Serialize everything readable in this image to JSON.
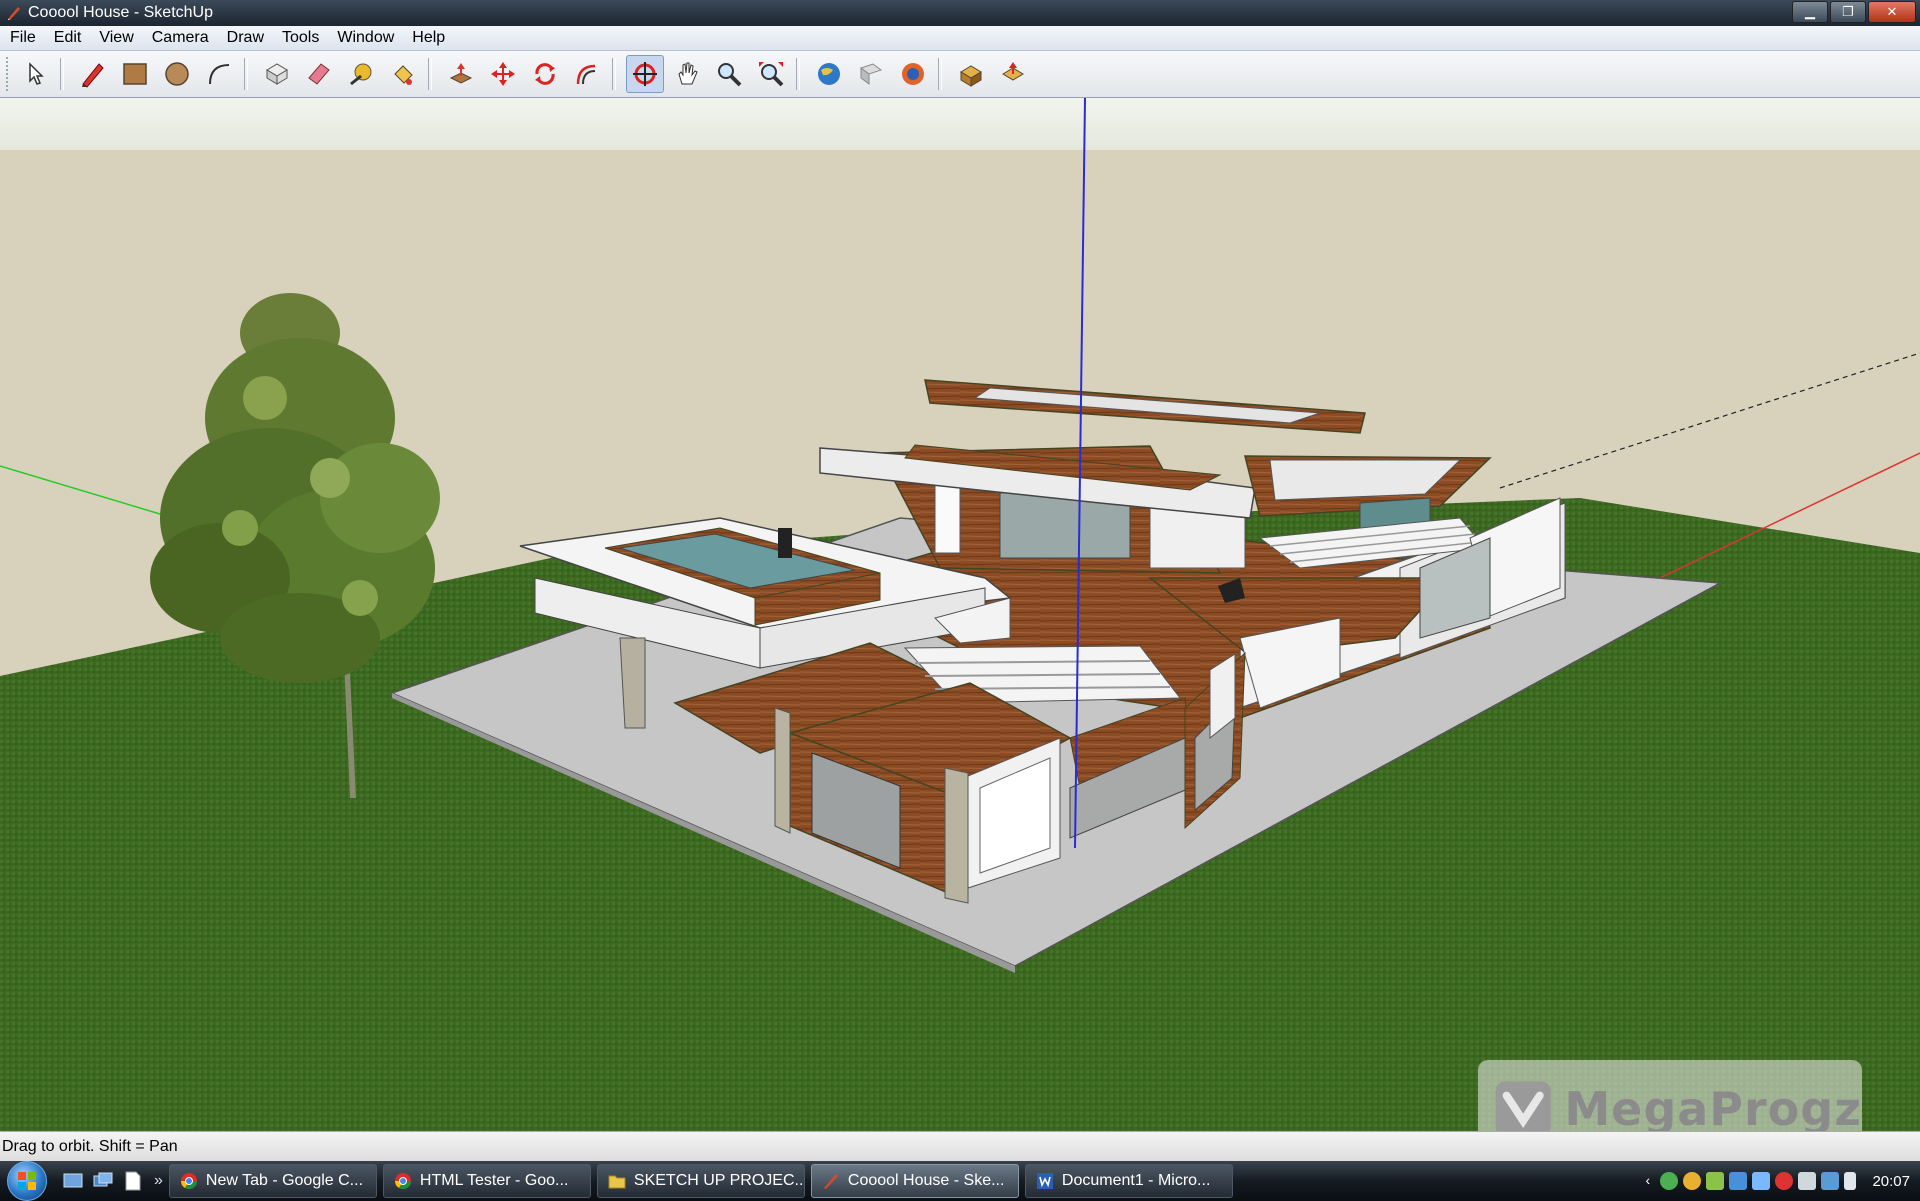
{
  "window": {
    "title": "Cooool House - SketchUp",
    "minimize_label": "▁",
    "maximize_label": "❐",
    "close_label": "✕"
  },
  "menu": {
    "items": [
      "File",
      "Edit",
      "View",
      "Camera",
      "Draw",
      "Tools",
      "Window",
      "Help"
    ]
  },
  "toolbar": {
    "tools": [
      "select-icon",
      "pencil-icon",
      "rectangle-icon",
      "circle-icon",
      "arc-icon",
      "make-component-icon",
      "eraser-icon",
      "tape-measure-icon",
      "paint-bucket-icon",
      "push-pull-icon",
      "move-icon",
      "rotate-icon",
      "offset-icon",
      "orbit-icon",
      "pan-icon",
      "zoom-icon",
      "zoom-extents-icon",
      "google-earth-icon",
      "get-models-icon",
      "share-model-icon",
      "component-icon",
      "extension-icon"
    ],
    "active_tool": "orbit-icon"
  },
  "status": {
    "text": "Drag to orbit.  Shift = Pan"
  },
  "taskbar": {
    "more_label": "»",
    "tasks": [
      {
        "label": "New Tab - Google C...",
        "icon": "chrome-icon"
      },
      {
        "label": "HTML Tester - Goo...",
        "icon": "chrome-icon"
      },
      {
        "label": "SKETCH UP PROJEC...",
        "icon": "folder-icon"
      },
      {
        "label": "Cooool House - Ske...",
        "icon": "sketchup-icon"
      },
      {
        "label": "Document1 - Micro...",
        "icon": "word-icon"
      }
    ],
    "active_task": 3,
    "clock": "20:07"
  },
  "watermark": {
    "text": "MegaProgz"
  },
  "colors": {
    "sky": "#e9ecdf",
    "background_wall": "#d8d2bd",
    "ground": "#3f6b22",
    "slab": "#c7c7c7",
    "wood": "#8a4a22",
    "white_wall": "#f4f4f4",
    "glass": "#5f8d8e",
    "axis_blue": "#2a2ad8",
    "axis_red": "#d33",
    "axis_green": "#2c2"
  }
}
